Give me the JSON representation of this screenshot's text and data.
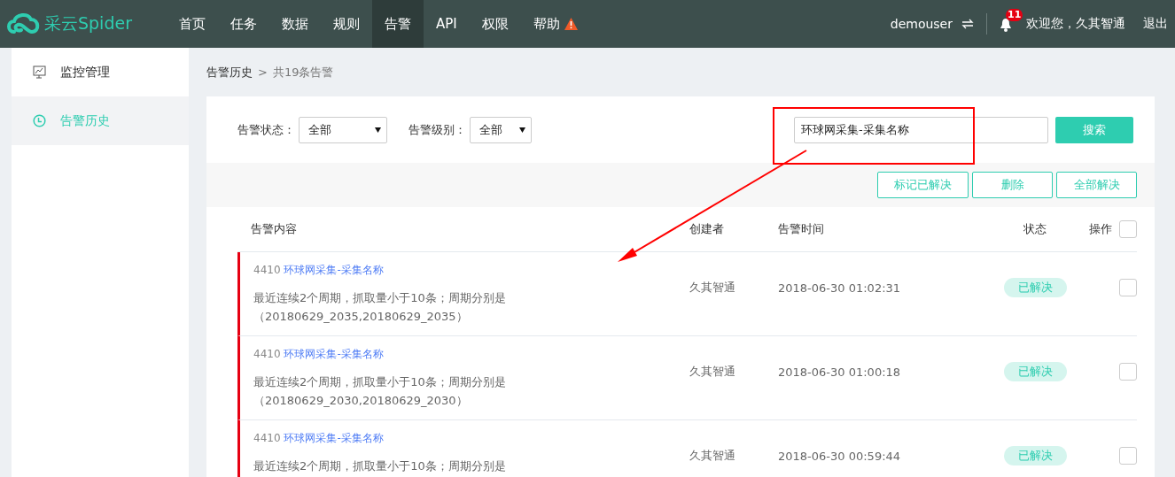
{
  "brand": {
    "name": "采云Spider"
  },
  "nav": [
    {
      "label": "首页",
      "selected": false,
      "warning": false
    },
    {
      "label": "任务",
      "selected": false,
      "warning": false
    },
    {
      "label": "数据",
      "selected": false,
      "warning": false
    },
    {
      "label": "规则",
      "selected": false,
      "warning": false
    },
    {
      "label": "告警",
      "selected": true,
      "warning": false
    },
    {
      "label": "API",
      "selected": false,
      "warning": false
    },
    {
      "label": "权限",
      "selected": false,
      "warning": false
    },
    {
      "label": "帮助",
      "selected": false,
      "warning": true
    }
  ],
  "user": {
    "name": "demouser",
    "notification_count": "11",
    "welcome": "欢迎您，久其智通",
    "logout": "退出"
  },
  "sidebar": {
    "items": [
      {
        "label": "监控管理",
        "kind": "monitor",
        "selected": false
      },
      {
        "label": "告警历史",
        "kind": "clock",
        "selected": true
      }
    ]
  },
  "breadcrumb": {
    "current": "告警历史",
    "separator": ">",
    "summary": "共19条告警"
  },
  "filters": [
    {
      "label": "告警状态：",
      "value": "全部"
    },
    {
      "label": "告警级别：",
      "value": "全部"
    }
  ],
  "search": {
    "value": "环球网采集-采集名称",
    "button": "搜索"
  },
  "actions": [
    "标记已解决",
    "删除",
    "全部解决"
  ],
  "table": {
    "columns": [
      "告警内容",
      "创建者",
      "告警时间",
      "状态",
      "操作"
    ],
    "select_all": {
      "checked": false
    },
    "rows": [
      {
        "id": "4410",
        "task": "环球网采集-采集名称",
        "message": "最近连续2个周期，抓取量小于10条；周期分别是（20180629_2035,20180629_2035）",
        "creator": "久其智通",
        "time": "2018-06-30 01:02:31",
        "status": "已解决",
        "checked": false
      },
      {
        "id": "4410",
        "task": "环球网采集-采集名称",
        "message": "最近连续2个周期，抓取量小于10条；周期分别是（20180629_2030,20180629_2030）",
        "creator": "久其智通",
        "time": "2018-06-30 01:00:18",
        "status": "已解决",
        "checked": false
      },
      {
        "id": "4410",
        "task": "环球网采集-采集名称",
        "message": "最近连续2个周期，抓取量小于10条；周期分别是",
        "creator": "久其智通",
        "time": "2018-06-30 00:59:44",
        "status": "已解决",
        "checked": false
      }
    ]
  }
}
